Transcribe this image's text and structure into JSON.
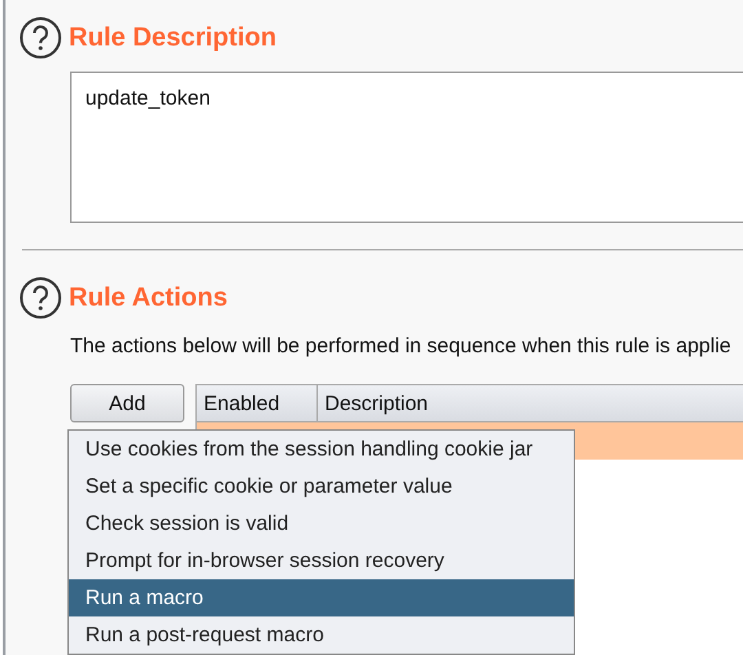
{
  "sections": [
    {
      "title": "Rule Description",
      "field": {
        "value": "update_token"
      }
    },
    {
      "title": "Rule Actions",
      "description": "The actions below will be performed in sequence when this rule is applie",
      "add_button": "Add",
      "table": {
        "columns": [
          "Enabled",
          "Description"
        ],
        "rows": [
          {
            "selected": true
          }
        ]
      }
    }
  ],
  "menu": {
    "items": [
      {
        "label": "Use cookies from the session handling cookie jar",
        "selected": false
      },
      {
        "label": "Set a specific cookie or parameter value",
        "selected": false
      },
      {
        "label": "Check session is valid",
        "selected": false
      },
      {
        "label": "Prompt for in-browser session recovery",
        "selected": false
      },
      {
        "label": "Run a macro",
        "selected": true
      },
      {
        "label": "Run a post-request macro",
        "selected": false
      }
    ]
  }
}
